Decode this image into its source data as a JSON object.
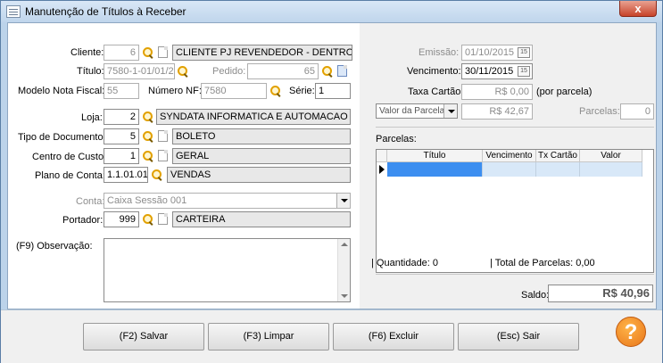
{
  "window": {
    "title": "Manutenção de Títulos à Receber",
    "close": "x"
  },
  "left": {
    "cliente": {
      "label": "Cliente:",
      "code": "6",
      "name": "CLIENTE PJ REVENDEDOR - DENTRO UI"
    },
    "titulo": {
      "label": "Título:",
      "value": "7580-1-01/01/2"
    },
    "pedido": {
      "label": "Pedido:",
      "value": "65"
    },
    "modelo": {
      "label": "Modelo Nota Fiscal:",
      "value": "55"
    },
    "numero_nf": {
      "label": "Número NF:",
      "value": "7580"
    },
    "serie": {
      "label": "Série:",
      "value": "1"
    },
    "loja": {
      "label": "Loja:",
      "code": "2",
      "name": "SYNDATA INFORMATICA E AUTOMACAO CO"
    },
    "tipo_doc": {
      "label": "Tipo de Documento:",
      "code": "5",
      "name": "BOLETO"
    },
    "centro_custo": {
      "label": "Centro de Custo:",
      "code": "1",
      "name": "GERAL"
    },
    "plano_conta": {
      "label": "Plano de Conta:",
      "code": "1.1.01.01",
      "name": "VENDAS"
    },
    "conta": {
      "label": "Conta:",
      "value": "Caixa Sessão 001"
    },
    "portador": {
      "label": "Portador:",
      "code": "999",
      "name": "CARTEIRA"
    },
    "observacao": {
      "label": "(F9) Observação:",
      "value": ""
    }
  },
  "right": {
    "emissao": {
      "label": "Emissão:",
      "value": "01/10/2015"
    },
    "vencimento": {
      "label": "Vencimento:",
      "value": "30/11/2015"
    },
    "taxa": {
      "label": "Taxa Cartão:",
      "value": "R$ 0,00",
      "suffix": "(por parcela)"
    },
    "valor_parcela": {
      "select": "Valor da Parcela",
      "value": "R$ 42,67"
    },
    "parcelas": {
      "label": "Parcelas:",
      "value": "0"
    },
    "grid_title": "Parcelas:",
    "columns": [
      "Título",
      "Vencimento",
      "Tx Cartão",
      "Valor"
    ],
    "quantidade": "Quantidade: 0",
    "total_parcelas": "Total de Parcelas: 0,00",
    "saldo": {
      "label": "Saldo:",
      "value": "R$ 40,96"
    }
  },
  "buttons": {
    "salvar": "(F2) Salvar",
    "limpar": "(F3) Limpar",
    "excluir": "(F6) Excluir",
    "sair": "(Esc) Sair"
  },
  "help": "?",
  "cal_icon": "15"
}
